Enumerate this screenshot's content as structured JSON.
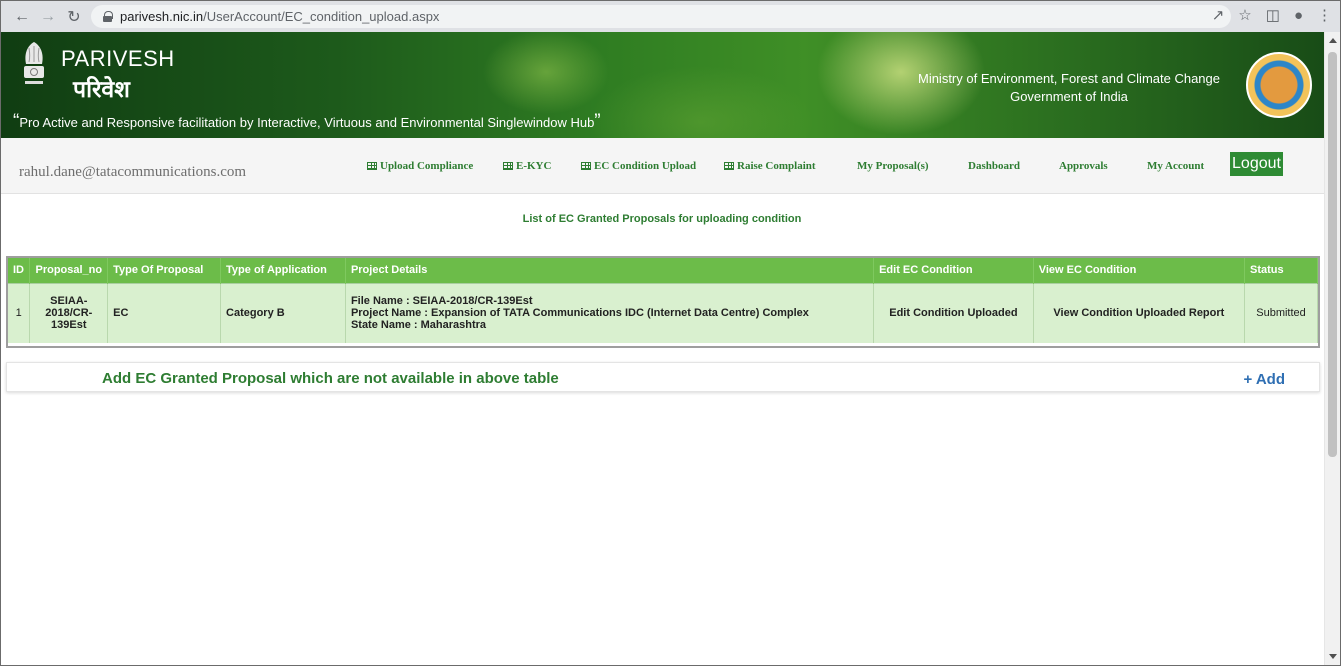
{
  "browser": {
    "url_host": "parivesh.nic.in",
    "url_path": "/UserAccount/EC_condition_upload.aspx"
  },
  "banner": {
    "brand_en": "PARIVESH",
    "brand_hi": "परिवेश",
    "tagline": "Pro Active and Responsive facilitation by Interactive, Virtuous and Environmental Singlewindow Hub",
    "ministry_line1": "Ministry of Environment, Forest and Climate Change",
    "ministry_line2": "Government of India"
  },
  "nav": {
    "user_email": "rahul.dane@tatacommunications.com",
    "items": [
      {
        "label": "Upload Compliance",
        "icon": "grid-icon"
      },
      {
        "label": "E-KYC",
        "icon": "grid-icon"
      },
      {
        "label": "EC Condition Upload",
        "icon": "grid-icon"
      },
      {
        "label": "Raise Complaint",
        "icon": "grid-icon"
      },
      {
        "label": "My Proposal(s)"
      },
      {
        "label": "Dashboard"
      },
      {
        "label": "Approvals"
      },
      {
        "label": "My Account"
      }
    ],
    "logout_label": "Logout"
  },
  "page": {
    "list_title": "List of EC Granted Proposals for uploading condition"
  },
  "table": {
    "headers": [
      "ID",
      "Proposal_no",
      "Type Of Proposal",
      "Type of Application",
      "Project Details",
      "Edit EC Condition",
      "View EC Condition",
      "Status"
    ],
    "rows": [
      {
        "id": "1",
        "proposal_no": "SEIAA-2018/CR-139Est",
        "type_of_proposal": "EC",
        "type_of_application": "Category B",
        "details_file": "File Name : SEIAA-2018/CR-139Est",
        "details_project": "Project Name : Expansion of TATA Communications IDC (Internet Data Centre) Complex",
        "details_state": "State Name : Maharashtra",
        "edit": "Edit Condition Uploaded",
        "view": "View Condition Uploaded Report",
        "status": "Submitted"
      }
    ]
  },
  "add_section": {
    "text": "Add EC Granted Proposal which are not available in above table",
    "button": "+ Add"
  }
}
